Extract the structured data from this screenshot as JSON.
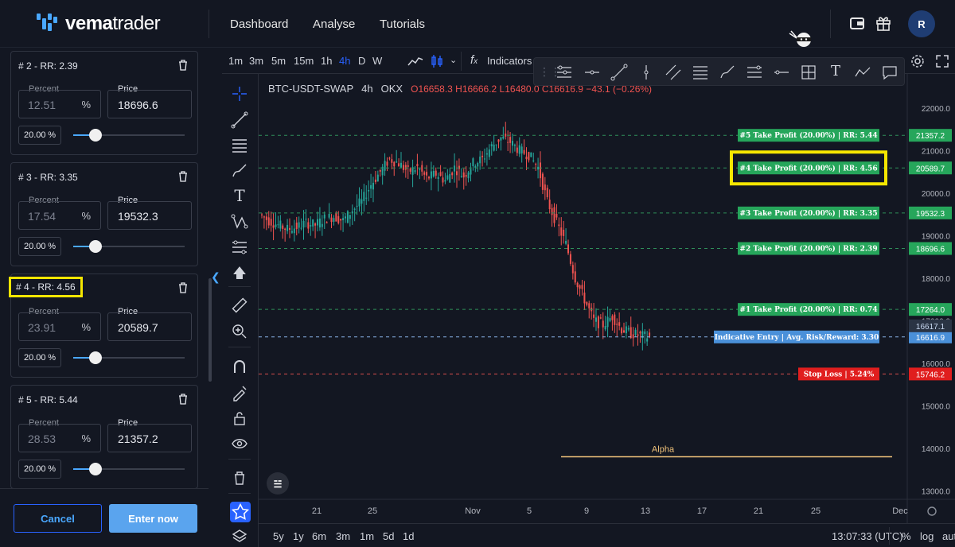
{
  "app": {
    "logo_bold": "vema",
    "logo_light": "trader",
    "nav": [
      "Dashboard",
      "Analyse",
      "Tutorials"
    ],
    "avatar_initial": "R"
  },
  "panel": {
    "cards": [
      {
        "title": "# 2 - RR: 2.39",
        "percent_label": "Percent",
        "percent_value": "12.51",
        "percent_unit": "%",
        "price_label": "Price",
        "price_value": "18696.6",
        "alloc": "20.00",
        "alloc_unit": "%",
        "slider_fraction": 0.2
      },
      {
        "title": "# 3 - RR: 3.35",
        "percent_label": "Percent",
        "percent_value": "17.54",
        "percent_unit": "%",
        "price_label": "Price",
        "price_value": "19532.3",
        "alloc": "20.00",
        "alloc_unit": "%",
        "slider_fraction": 0.2
      },
      {
        "title": "# 4 - RR: 4.56",
        "percent_label": "Percent",
        "percent_value": "23.91",
        "percent_unit": "%",
        "price_label": "Price",
        "price_value": "20589.7",
        "alloc": "20.00",
        "alloc_unit": "%",
        "slider_fraction": 0.2
      },
      {
        "title": "# 5 - RR: 5.44",
        "percent_label": "Percent",
        "percent_value": "28.53",
        "percent_unit": "%",
        "price_label": "Price",
        "price_value": "21357.2",
        "alloc": "20.00",
        "alloc_unit": "%",
        "slider_fraction": 0.2
      }
    ],
    "cancel_label": "Cancel",
    "enter_label": "Enter now"
  },
  "toolbar": {
    "timeframes": [
      "1m",
      "3m",
      "5m",
      "15m",
      "1h",
      "4h",
      "D",
      "W"
    ],
    "active_timeframe": "4h",
    "indicators_label": "Indicators"
  },
  "symbol": {
    "name": "BTC-USDT-SWAP",
    "interval": "4h",
    "exchange": "OKX",
    "ohlc": "O16658.3 H16666.2 L16480.0 C16616.9 −43.1 (−0.26%)"
  },
  "chart_data": {
    "type": "candlestick",
    "price_axis": [
      "22000.0",
      "21000.0",
      "20000.0",
      "19000.0",
      "18000.0",
      "17000.0",
      "16000.0",
      "15000.0",
      "14000.0",
      "13000.0"
    ],
    "time_axis": [
      "21",
      "25",
      "Nov",
      "5",
      "9",
      "13",
      "17",
      "21",
      "25",
      "Dec"
    ],
    "ylim": [
      12800,
      22800
    ],
    "candles_close_path": [
      19500,
      19350,
      19250,
      19150,
      19200,
      19300,
      19250,
      19400,
      19450,
      19350,
      19600,
      19800,
      20200,
      20500,
      20800,
      20700,
      20500,
      20600,
      20350,
      20450,
      20300,
      20600,
      20400,
      20700,
      20800,
      21100,
      21300,
      21200,
      21000,
      20900,
      20600,
      19800,
      19300,
      18800,
      18000,
      17500,
      17000,
      16900,
      17100,
      16800,
      16700,
      16650,
      16617
    ],
    "levels": [
      {
        "label": "#5 Take Profit (20.00%) | RR: 5.44",
        "price": 21357.2,
        "tag": "21357.2",
        "color": "#26a65b",
        "highlight": false
      },
      {
        "label": "#4 Take Profit (20.00%) | RR: 4.56",
        "price": 20589.7,
        "tag": "20589.7",
        "color": "#26a65b",
        "highlight": true
      },
      {
        "label": "#3 Take Profit (20.00%) | RR: 3.35",
        "price": 19532.3,
        "tag": "19532.3",
        "color": "#26a65b",
        "highlight": false
      },
      {
        "label": "#2 Take Profit (20.00%) | RR: 2.39",
        "price": 18696.6,
        "tag": "18696.6",
        "color": "#26a65b",
        "highlight": false
      },
      {
        "label": "#1 Take Profit (20.00%) | RR: 0.74",
        "price": 17264.0,
        "tag": "17264.0",
        "color": "#26a65b",
        "highlight": false
      },
      {
        "label": "Indicative Entry | Avg. Risk/Reward: 3.30",
        "price": 16616.9,
        "tag": "16616.9",
        "color": "#4a90d9",
        "highlight": false
      },
      {
        "label": "Stop Loss | 5.24%",
        "price": 15746.2,
        "tag": "15746.2",
        "color": "#e01e1e",
        "highlight": false
      }
    ],
    "last_price_tag": "16617.1",
    "annotation": {
      "text": "Alpha",
      "price": 13800
    }
  },
  "bottom": {
    "ranges": [
      "5y",
      "1y",
      "6m",
      "3m",
      "1m",
      "5d",
      "1d"
    ],
    "clock": "13:07:33 (UTC)",
    "percent": "%",
    "log": "log",
    "auto": "auto"
  }
}
